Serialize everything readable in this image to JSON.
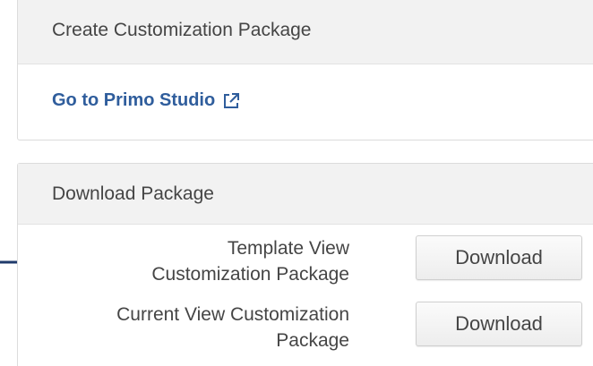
{
  "create_panel": {
    "title": "Create Customization Package",
    "studio_link": "Go to Primo Studio",
    "external_link_icon": "external-link-icon"
  },
  "download_panel": {
    "title": "Download Package",
    "rows": [
      {
        "label_line1": "Template View",
        "label_line2": "Customization Package",
        "button": "Download"
      },
      {
        "label_line1": "Current View Customization",
        "label_line2": "Package",
        "button": "Download"
      }
    ]
  },
  "annotation": {
    "icon": "arrow-right-icon",
    "color": "#1f3a6b"
  },
  "colors": {
    "link": "#2f5d9c",
    "header_bg": "#f2f2f2",
    "text": "#454545",
    "border": "#dcdcdc"
  }
}
